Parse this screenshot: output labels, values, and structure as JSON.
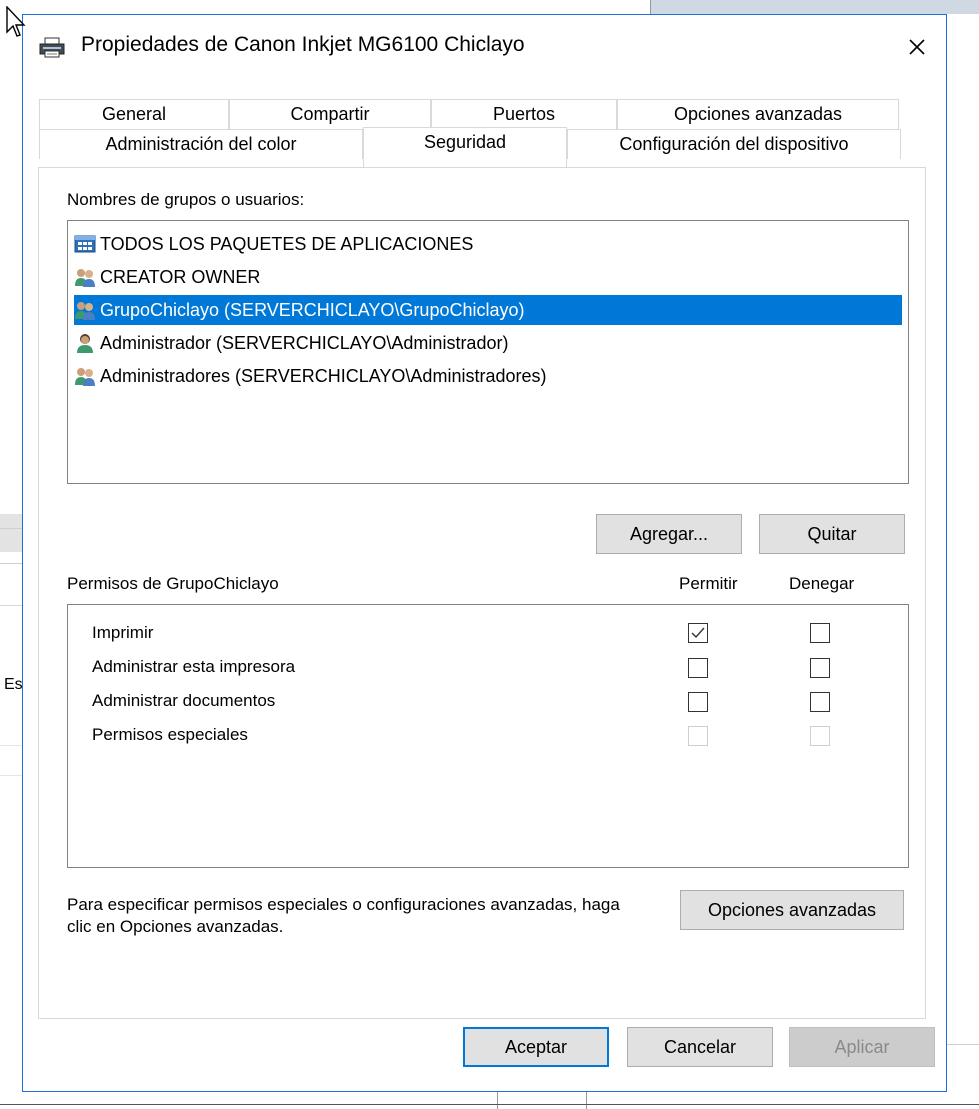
{
  "window": {
    "title": "Propiedades de Canon Inkjet MG6100 Chiclayo",
    "close_symbol": "✕"
  },
  "tabs_row1": [
    "General",
    "Compartir",
    "Puertos",
    "Opciones avanzadas"
  ],
  "tabs_row2": [
    "Administración del color",
    "Seguridad",
    "Configuración del dispositivo"
  ],
  "active_tab": "Seguridad",
  "groups": {
    "label": "Nombres de grupos o usuarios:",
    "items": [
      {
        "name": "TODOS LOS PAQUETES DE APLICACIONES",
        "icon": "app-packages-icon",
        "selected": false
      },
      {
        "name": "CREATOR OWNER",
        "icon": "users-group-icon",
        "selected": false
      },
      {
        "name": "GrupoChiclayo (SERVERCHICLAYO\\GrupoChiclayo)",
        "icon": "users-group-icon",
        "selected": true
      },
      {
        "name": "Administrador (SERVERCHICLAYO\\Administrador)",
        "icon": "user-icon",
        "selected": false
      },
      {
        "name": "Administradores (SERVERCHICLAYO\\Administradores)",
        "icon": "users-group-icon",
        "selected": false
      }
    ]
  },
  "buttons": {
    "add": "Agregar...",
    "remove": "Quitar",
    "advanced": "Opciones avanzadas",
    "ok": "Aceptar",
    "cancel": "Cancelar",
    "apply": "Aplicar"
  },
  "permissions": {
    "label": "Permisos de GrupoChiclayo",
    "allow_header": "Permitir",
    "deny_header": "Denegar",
    "rows": [
      {
        "name": "Imprimir",
        "allow": true,
        "deny": false,
        "enabled": true
      },
      {
        "name": "Administrar esta impresora",
        "allow": false,
        "deny": false,
        "enabled": true
      },
      {
        "name": "Administrar documentos",
        "allow": false,
        "deny": false,
        "enabled": true
      },
      {
        "name": "Permisos especiales",
        "allow": false,
        "deny": false,
        "enabled": false
      }
    ]
  },
  "help_text": "Para especificar permisos especiales o configuraciones avanzadas, haga clic en Opciones avanzadas.",
  "background": {
    "left_fragment": "Es"
  }
}
